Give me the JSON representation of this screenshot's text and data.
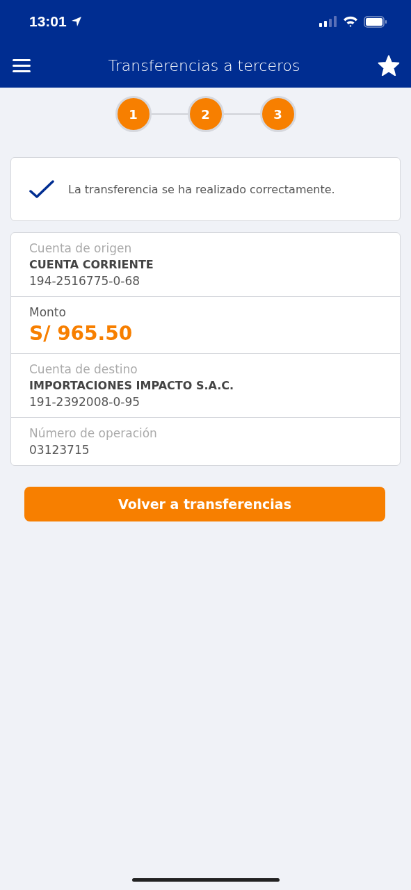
{
  "status_bar": {
    "time": "13:01"
  },
  "header": {
    "title": "Transferencias a terceros"
  },
  "steps": [
    "1",
    "2",
    "3"
  ],
  "success": {
    "message": "La transferencia se ha realizado correctamente."
  },
  "details": [
    {
      "kind": "account",
      "label": "Cuenta de origen",
      "name": "CUENTA CORRIENTE",
      "number": "194-2516775-0-68"
    },
    {
      "kind": "amount",
      "label": "Monto",
      "value": "S/ 965.50"
    },
    {
      "kind": "account",
      "label": "Cuenta de destino",
      "name": "IMPORTACIONES IMPACTO S.A.C.",
      "number": "191-2392008-0-95"
    },
    {
      "kind": "operation",
      "label": "Número de operación",
      "value": "03123715"
    }
  ],
  "button": "Volver a transferencias"
}
